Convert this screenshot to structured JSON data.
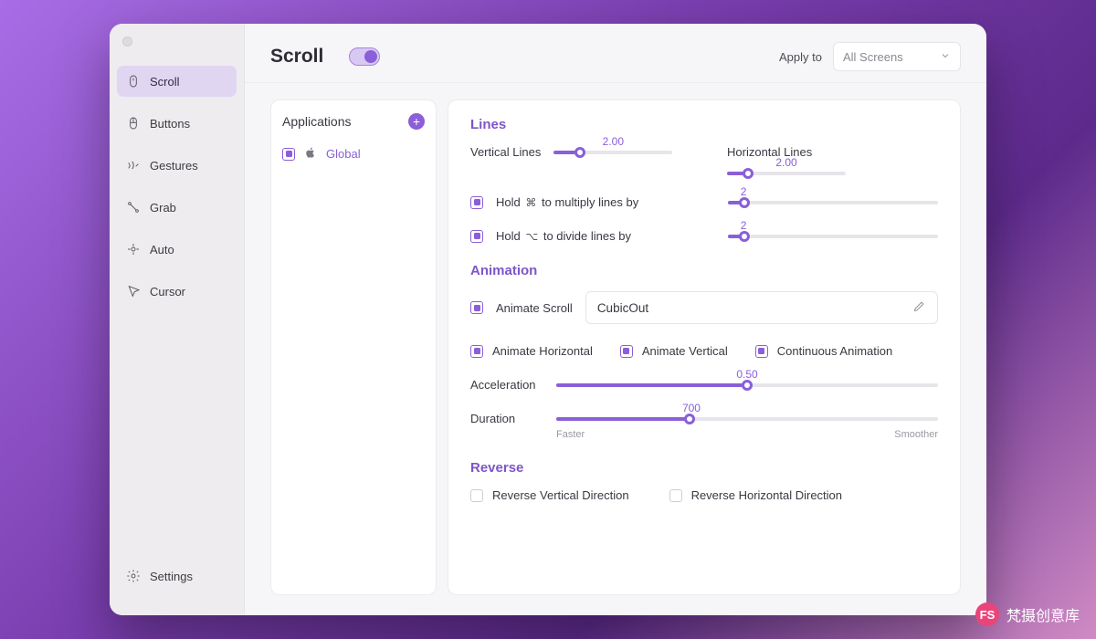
{
  "sidebar": {
    "items": [
      {
        "label": "Scroll"
      },
      {
        "label": "Buttons"
      },
      {
        "label": "Gestures"
      },
      {
        "label": "Grab"
      },
      {
        "label": "Auto"
      },
      {
        "label": "Cursor"
      }
    ],
    "settings_label": "Settings"
  },
  "header": {
    "title": "Scroll",
    "apply_to_label": "Apply to",
    "dropdown_value": "All Screens"
  },
  "apps": {
    "title": "Applications",
    "global_label": "Global"
  },
  "lines": {
    "title": "Lines",
    "vertical_label": "Vertical Lines",
    "vertical_value": "2.00",
    "horizontal_label": "Horizontal Lines",
    "horizontal_value": "2.00",
    "hold_multiply_prefix": "Hold",
    "hold_multiply_key": "⌘",
    "hold_multiply_suffix": "to multiply lines by",
    "multiply_value": "2",
    "hold_divide_prefix": "Hold",
    "hold_divide_key": "⌥",
    "hold_divide_suffix": "to divide lines by",
    "divide_value": "2"
  },
  "animation": {
    "title": "Animation",
    "animate_scroll_label": "Animate Scroll",
    "easing_value": "CubicOut",
    "animate_horizontal_label": "Animate Horizontal",
    "animate_vertical_label": "Animate Vertical",
    "continuous_label": "Continuous Animation",
    "acceleration_label": "Acceleration",
    "acceleration_value": "0.50",
    "duration_label": "Duration",
    "duration_value": "700",
    "duration_hint_left": "Faster",
    "duration_hint_right": "Smoother"
  },
  "reverse": {
    "title": "Reverse",
    "vertical_label": "Reverse Vertical Direction",
    "horizontal_label": "Reverse Horizontal Direction"
  },
  "watermark": "梵摄创意库"
}
